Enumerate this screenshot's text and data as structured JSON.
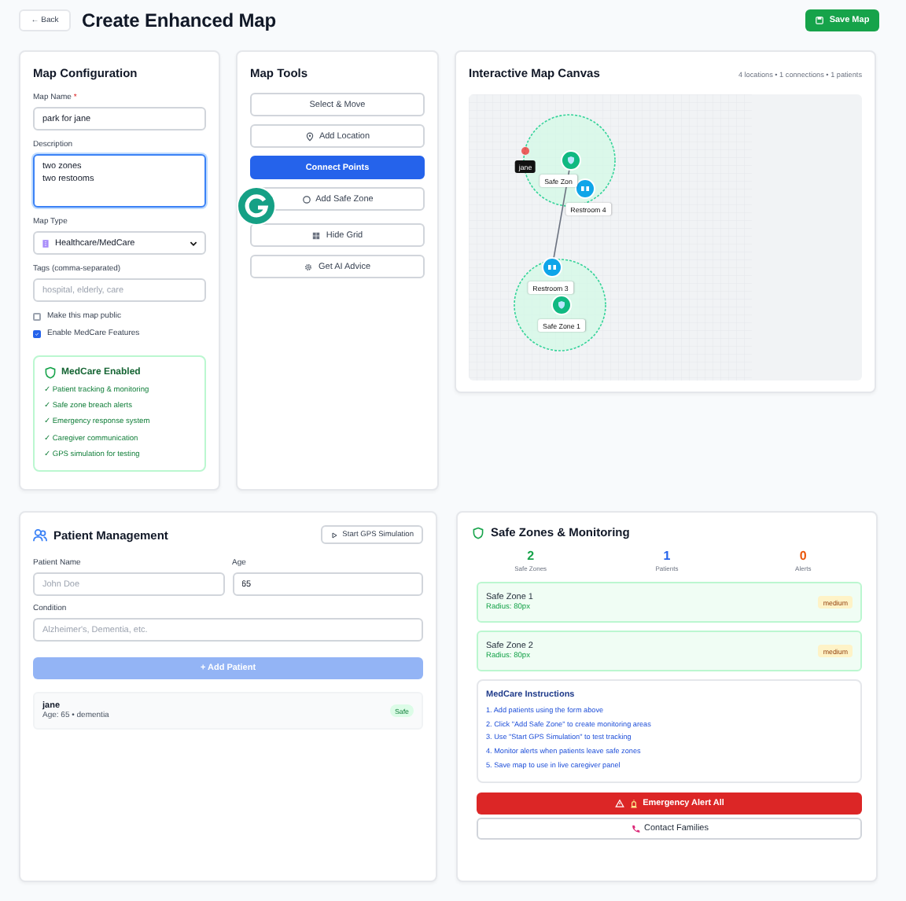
{
  "header": {
    "back": "← Back",
    "title": "Create Enhanced Map",
    "save": "Save Map"
  },
  "config": {
    "title": "Map Configuration",
    "name_label": "Map Name",
    "required_mark": "*",
    "name_value": "park for jane",
    "description_label": "Description",
    "description_value": "two zones\ntwo restooms",
    "type_label": "Map Type",
    "type_value": "Healthcare/MedCare",
    "tags_label": "Tags (comma-separated)",
    "tags_placeholder": "hospital, elderly, care",
    "checkboxes": [
      {
        "label": "Make this map public",
        "checked": false
      },
      {
        "label": "Enable MedCare Features",
        "checked": true
      }
    ],
    "medcare": {
      "title": "MedCare Enabled",
      "features": [
        "✓ Patient tracking & monitoring",
        "✓ Safe zone breach alerts",
        "✓ Emergency response system",
        "✓ Caregiver communication",
        "✓ GPS simulation for testing"
      ]
    }
  },
  "tools": {
    "title": "Map Tools",
    "buttons": [
      {
        "label": "Select & Move",
        "selected": false
      },
      {
        "label": "Add Location",
        "selected": false
      },
      {
        "label": "Connect Points",
        "selected": true
      },
      {
        "label": "Add Safe Zone",
        "selected": false
      },
      {
        "label": "Hide Grid",
        "selected": false
      },
      {
        "label": "Get AI Advice",
        "selected": false
      }
    ]
  },
  "canvas": {
    "title": "Interactive Map Canvas",
    "stats": "4 locations • 1 connections • 1 patients",
    "nodes": [
      {
        "kind": "zone",
        "label": "Safe Zon"
      },
      {
        "kind": "restroom",
        "label": "Restroom 4"
      },
      {
        "kind": "restroom",
        "label": "Restroom 3"
      },
      {
        "kind": "zone",
        "label": "Safe Zone 1"
      }
    ],
    "patients": [
      {
        "name": "jane"
      }
    ]
  },
  "patients": {
    "title": "Patient Management",
    "sim_button": "Start GPS Simulation",
    "name_label": "Patient Name",
    "name_placeholder": "John Doe",
    "age_label": "Age",
    "age_value": "65",
    "condition_label": "Condition",
    "condition_placeholder": "Alzheimer's, Dementia, etc.",
    "add_button": {
      "label": "+ Add Patient",
      "disabled": true
    },
    "list": [
      {
        "name": "jane",
        "detail": "Age: 65 • dementia",
        "status": "Safe"
      }
    ]
  },
  "zones": {
    "title": "Safe Zones & Monitoring",
    "stats": [
      {
        "value": "2",
        "label": "Safe Zones",
        "color": "#16a34a"
      },
      {
        "value": "1",
        "label": "Patients",
        "color": "#2563eb"
      },
      {
        "value": "0",
        "label": "Alerts",
        "color": "#ea580c"
      }
    ],
    "list": [
      {
        "name": "Safe Zone 1",
        "radius": "Radius: 80px",
        "tag": "medium"
      },
      {
        "name": "Safe Zone 2",
        "radius": "Radius: 80px",
        "tag": "medium"
      }
    ],
    "instructions": {
      "title": "MedCare Instructions",
      "steps": [
        "1. Add patients using the form above",
        "2. Click \"Add Safe Zone\" to create monitoring areas",
        "3. Use \"Start GPS Simulation\" to test tracking",
        "4. Monitor alerts when patients leave safe zones",
        "5. Save map to use in live caregiver panel"
      ]
    },
    "alert_button": "Emergency Alert All",
    "contact_button": "Contact Families"
  }
}
